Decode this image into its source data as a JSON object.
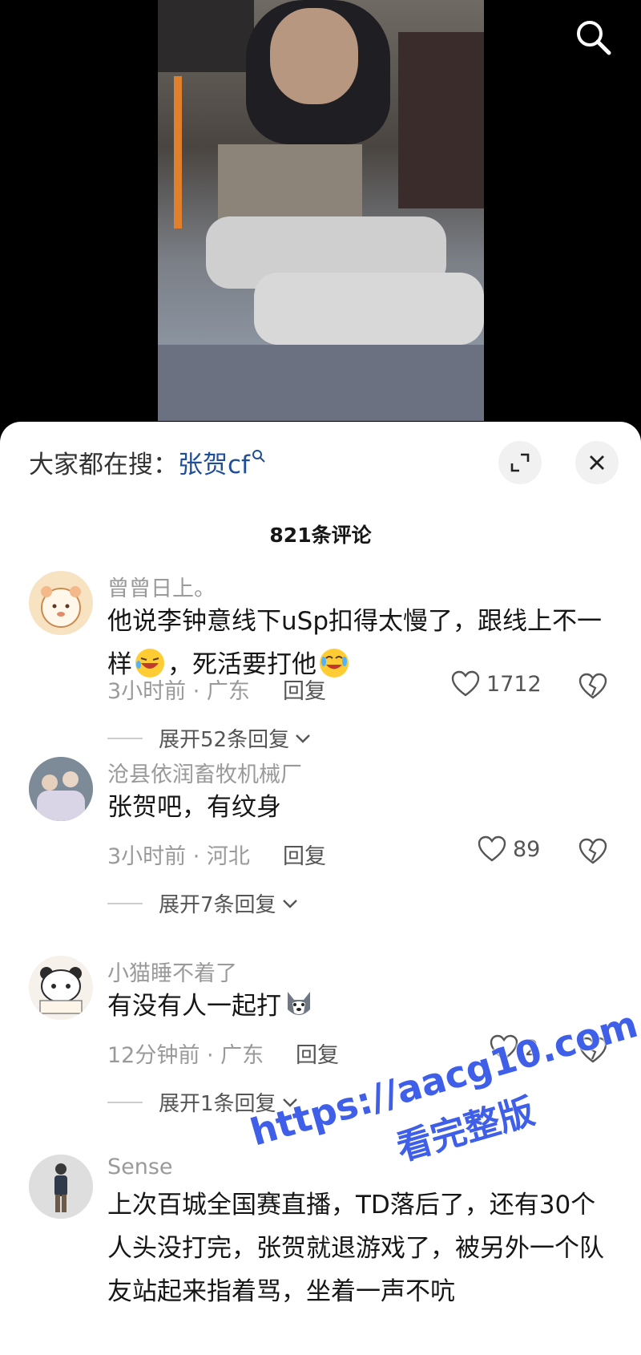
{
  "hot_search": {
    "label": "大家都在搜：",
    "keyword": "张贺cf"
  },
  "comment_count": "821条评论",
  "comments": [
    {
      "username": "曾曾日上。",
      "text_part1": "他说李钟意线下uSp扣得太慢了，跟线上不一样",
      "text_part2": "，死活要打他",
      "meta": "3小时前 · 广东",
      "reply_label": "回复",
      "likes": "1712",
      "expand": "展开52条回复"
    },
    {
      "username": "沧县依润畜牧机械厂",
      "text": "张贺吧，有纹身",
      "meta": "3小时前 · 河北",
      "reply_label": "回复",
      "likes": "89",
      "expand": "展开7条回复"
    },
    {
      "username": "小猫睡不着了",
      "text": "有没有人一起打",
      "meta": "12分钟前 · 广东",
      "reply_label": "回复",
      "likes": "2",
      "expand": "展开1条回复"
    },
    {
      "username": "Sense",
      "text": "上次百城全国赛直播，TD落后了，还有30个人头没打完，张贺就退游戏了，被另外一个队友站起来指着骂，坐着一声不吭"
    }
  ],
  "watermark": {
    "line1": "https://aacg10.com",
    "line2": "看完整版"
  },
  "icons": {
    "search": "search-icon",
    "expand": "fullscreen-icon",
    "close": "close-icon",
    "like": "heart-icon",
    "dislike": "broken-heart-icon"
  }
}
